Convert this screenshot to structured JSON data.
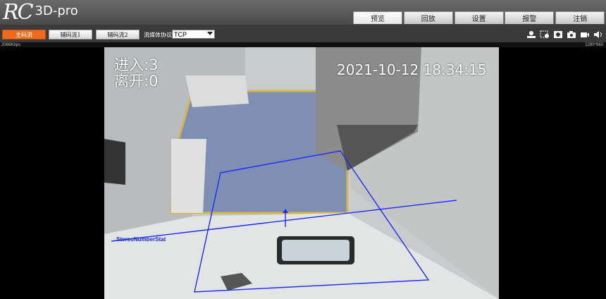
{
  "header": {
    "logo_mark": "RC",
    "product": "3D-pro",
    "tabs": [
      {
        "label": "预览",
        "active": true
      },
      {
        "label": "回放",
        "active": false
      },
      {
        "label": "设置",
        "active": false
      },
      {
        "label": "报警",
        "active": false
      },
      {
        "label": "注销",
        "active": false
      }
    ]
  },
  "toolbar": {
    "main_stream": "主码流",
    "sub_stream_1": "辅码流1",
    "sub_stream_2": "辅码流2",
    "protocol_label": "流媒体协议",
    "protocol_value": "TCP",
    "tool_icons": [
      "intercom-icon",
      "zoom-icon",
      "record-icon",
      "snapshot-icon",
      "video-icon",
      "audio-icon"
    ]
  },
  "info": {
    "bitrate": "2068Kbps",
    "resolution": "1280*960"
  },
  "video": {
    "timestamp": "2021-10-12 18:34:15",
    "enter_count": "进入:3",
    "leave_count": "离开:0",
    "rule_label": "StereoNumberStat",
    "overlay_color": "#1a2cff"
  },
  "colors": {
    "accent": "#f06a1e",
    "header_bg": "#5a5a5a",
    "toolbar_bg": "#3a3a3a"
  }
}
